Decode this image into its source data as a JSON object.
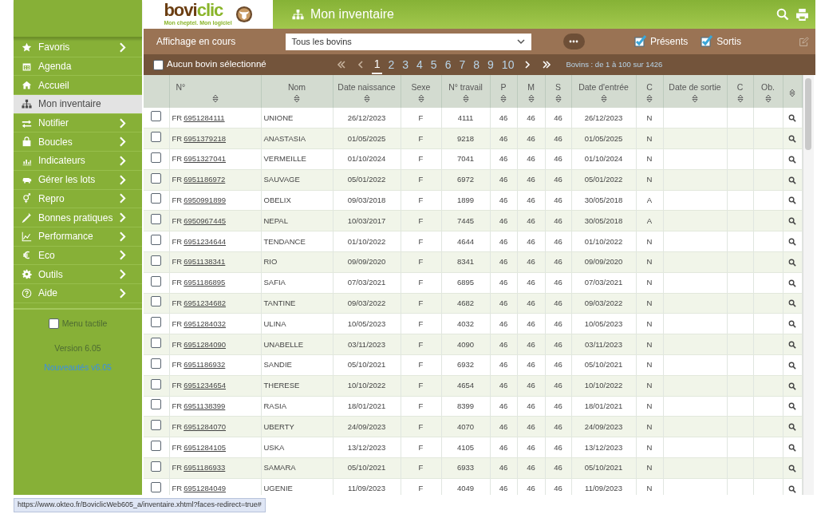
{
  "header": {
    "logo": {
      "brand_a": "bovi",
      "brand_b": "clic",
      "tagline": "Mon cheptel. Mon logiciel"
    },
    "title": "Mon inventaire"
  },
  "sidebar": {
    "items": [
      {
        "label": "Favoris",
        "kind": "star",
        "submenu": true,
        "selected": false
      },
      {
        "label": "Agenda",
        "kind": "calendar",
        "submenu": false,
        "selected": false
      },
      {
        "label": "Accueil",
        "kind": "home",
        "submenu": false,
        "selected": false
      },
      {
        "label": "Mon inventaire",
        "kind": "hierarchy",
        "submenu": false,
        "selected": true
      },
      {
        "label": "Notifier",
        "kind": "arrows",
        "submenu": true,
        "selected": false
      },
      {
        "label": "Boucles",
        "kind": "bag",
        "submenu": true,
        "selected": false
      },
      {
        "label": "Indicateurs",
        "kind": "bars",
        "submenu": true,
        "selected": false
      },
      {
        "label": "Gérer les lots",
        "kind": "pig",
        "submenu": true,
        "selected": false
      },
      {
        "label": "Repro",
        "kind": "gender",
        "submenu": true,
        "selected": false
      },
      {
        "label": "Bonnes pratiques",
        "kind": "pencil",
        "submenu": true,
        "selected": false
      },
      {
        "label": "Performance",
        "kind": "line",
        "submenu": true,
        "selected": false
      },
      {
        "label": "Eco",
        "kind": "euro",
        "submenu": true,
        "selected": false
      },
      {
        "label": "Outils",
        "kind": "gear",
        "submenu": true,
        "selected": false
      },
      {
        "label": "Aide",
        "kind": "help",
        "submenu": true,
        "selected": false
      }
    ],
    "touch_menu": {
      "label": "Menu tactile",
      "checked": false
    },
    "version": "Version 6.05",
    "news_link": "Nouveautés v6.05"
  },
  "filter_bar": {
    "label": "Affichage en cours",
    "select_value": "Tous les bovins",
    "filters": [
      {
        "label": "Présents",
        "checked": true
      },
      {
        "label": "Sortis",
        "checked": true
      }
    ]
  },
  "pager": {
    "selection": {
      "label": "Aucun bovin sélectionné",
      "checked": false
    },
    "pages": [
      {
        "label": "1",
        "selected": true
      },
      {
        "label": "2",
        "selected": false
      },
      {
        "label": "3",
        "selected": false
      },
      {
        "label": "4",
        "selected": false
      },
      {
        "label": "5",
        "selected": false
      },
      {
        "label": "6",
        "selected": false
      },
      {
        "label": "7",
        "selected": false
      },
      {
        "label": "8",
        "selected": false
      },
      {
        "label": "9",
        "selected": false
      },
      {
        "label": "10",
        "selected": false
      }
    ],
    "summary": "Bovins : de 1 à 100 sur 1426"
  },
  "table": {
    "columns": [
      "N°",
      "Nom",
      "Date naissance",
      "Sexe",
      "N° travail",
      "P",
      "M",
      "S",
      "Date d'entrée",
      "C",
      "Date de sortie",
      "C",
      "Ob."
    ],
    "rows": [
      {
        "selected": false,
        "prefix": "FR",
        "cells": [
          "6951284111",
          "UNIONE",
          "26/12/2023",
          "F",
          "4111",
          "46",
          "46",
          "46",
          "26/12/2023",
          "N"
        ]
      },
      {
        "selected": false,
        "prefix": "FR",
        "cells": [
          "6951379218",
          "ANASTASIA",
          "01/05/2025",
          "F",
          "9218",
          "46",
          "46",
          "46",
          "01/05/2025",
          "N"
        ]
      },
      {
        "selected": false,
        "prefix": "FR",
        "cells": [
          "6951327041",
          "VERMEILLE",
          "01/10/2024",
          "F",
          "7041",
          "46",
          "46",
          "46",
          "01/10/2024",
          "N"
        ]
      },
      {
        "selected": false,
        "prefix": "FR",
        "cells": [
          "6951186972",
          "SAUVAGE",
          "05/01/2022",
          "F",
          "6972",
          "46",
          "46",
          "46",
          "05/01/2022",
          "N"
        ]
      },
      {
        "selected": false,
        "prefix": "FR",
        "cells": [
          "6950991899",
          "OBELIX",
          "09/03/2018",
          "F",
          "1899",
          "46",
          "46",
          "46",
          "30/05/2018",
          "A"
        ]
      },
      {
        "selected": false,
        "prefix": "FR",
        "cells": [
          "6950967445",
          "NEPAL",
          "10/03/2017",
          "F",
          "7445",
          "46",
          "46",
          "46",
          "30/05/2018",
          "A"
        ]
      },
      {
        "selected": false,
        "prefix": "FR",
        "cells": [
          "6951234644",
          "TENDANCE",
          "01/10/2022",
          "F",
          "4644",
          "46",
          "46",
          "46",
          "01/10/2022",
          "N"
        ]
      },
      {
        "selected": false,
        "prefix": "FR",
        "cells": [
          "6951138341",
          "RIO",
          "09/09/2020",
          "F",
          "8341",
          "46",
          "46",
          "46",
          "09/09/2020",
          "N"
        ]
      },
      {
        "selected": false,
        "prefix": "FR",
        "cells": [
          "6951186895",
          "SAFIA",
          "07/03/2021",
          "F",
          "6895",
          "46",
          "46",
          "46",
          "07/03/2021",
          "N"
        ]
      },
      {
        "selected": false,
        "prefix": "FR",
        "cells": [
          "6951234682",
          "TANTINE",
          "09/03/2022",
          "F",
          "4682",
          "46",
          "46",
          "46",
          "09/03/2022",
          "N"
        ]
      },
      {
        "selected": false,
        "prefix": "FR",
        "cells": [
          "6951284032",
          "ULINA",
          "10/05/2023",
          "F",
          "4032",
          "46",
          "46",
          "46",
          "10/05/2023",
          "N"
        ]
      },
      {
        "selected": false,
        "prefix": "FR",
        "cells": [
          "6951284090",
          "UNABELLE",
          "03/11/2023",
          "F",
          "4090",
          "46",
          "46",
          "46",
          "03/11/2023",
          "N"
        ]
      },
      {
        "selected": false,
        "prefix": "FR",
        "cells": [
          "6951186932",
          "SANDIE",
          "05/10/2021",
          "F",
          "6932",
          "46",
          "46",
          "46",
          "05/10/2021",
          "N"
        ]
      },
      {
        "selected": false,
        "prefix": "FR",
        "cells": [
          "6951234654",
          "THERESE",
          "10/10/2022",
          "F",
          "4654",
          "46",
          "46",
          "46",
          "10/10/2022",
          "N"
        ]
      },
      {
        "selected": false,
        "prefix": "FR",
        "cells": [
          "6951138399",
          "RASIA",
          "18/01/2021",
          "F",
          "8399",
          "46",
          "46",
          "46",
          "18/01/2021",
          "N"
        ]
      },
      {
        "selected": false,
        "prefix": "FR",
        "cells": [
          "6951284070",
          "UBERTY",
          "24/09/2023",
          "F",
          "4070",
          "46",
          "46",
          "46",
          "24/09/2023",
          "N"
        ]
      },
      {
        "selected": false,
        "prefix": "FR",
        "cells": [
          "6951284105",
          "USKA",
          "13/12/2023",
          "F",
          "4105",
          "46",
          "46",
          "46",
          "13/12/2023",
          "N"
        ]
      },
      {
        "selected": false,
        "prefix": "FR",
        "cells": [
          "6951186933",
          "SAMARA",
          "05/10/2021",
          "F",
          "6933",
          "46",
          "46",
          "46",
          "05/10/2021",
          "N"
        ]
      },
      {
        "selected": false,
        "prefix": "FR",
        "cells": [
          "6951284049",
          "UGENIE",
          "11/09/2023",
          "F",
          "4049",
          "46",
          "46",
          "46",
          "11/09/2023",
          "N"
        ]
      }
    ]
  },
  "status_url": "https://www.okteo.fr/BoviclicWeb605_a/inventaire.xhtml?faces-redirect=true#"
}
